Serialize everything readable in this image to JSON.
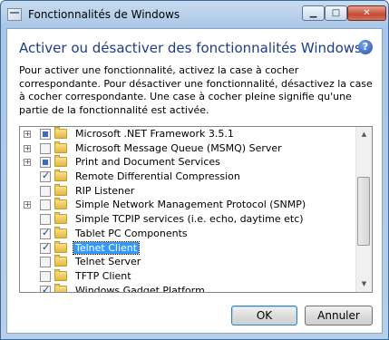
{
  "window": {
    "title": "Fonctionnalités de Windows",
    "icon": "windows-features-icon",
    "buttons": {
      "minimize": "▁",
      "maximize": "□",
      "close": "✕"
    }
  },
  "heading": "Activer ou désactiver des fonctionnalités Windows",
  "help_icon": "?",
  "description": "Pour activer une fonctionnalité, activez la case à cocher correspondante. Pour désactiver une fonctionnalité, désactivez la case à cocher correspondante. Une case à cocher pleine signifie qu'une partie de la fonctionnalité est activée.",
  "features": [
    {
      "label": "Microsoft .NET Framework 3.5.1",
      "expander": "+",
      "state": "partial"
    },
    {
      "label": "Microsoft Message Queue (MSMQ) Server",
      "expander": "+",
      "state": "unchecked"
    },
    {
      "label": "Print and Document Services",
      "expander": "+",
      "state": "partial"
    },
    {
      "label": "Remote Differential Compression",
      "expander": "",
      "state": "checked"
    },
    {
      "label": "RIP Listener",
      "expander": "",
      "state": "unchecked"
    },
    {
      "label": "Simple Network Management Protocol (SNMP)",
      "expander": "+",
      "state": "unchecked"
    },
    {
      "label": "Simple TCPIP services (i.e. echo, daytime etc)",
      "expander": "",
      "state": "unchecked"
    },
    {
      "label": "Tablet PC Components",
      "expander": "",
      "state": "checked"
    },
    {
      "label": "Telnet Client",
      "expander": "",
      "state": "checked",
      "selected": true
    },
    {
      "label": "Telnet Server",
      "expander": "",
      "state": "unchecked"
    },
    {
      "label": "TFTP Client",
      "expander": "",
      "state": "unchecked"
    },
    {
      "label": "Windows Gadget Platform",
      "expander": "",
      "state": "checked"
    }
  ],
  "scroll": {
    "up": "▲",
    "down": "▼"
  },
  "footer": {
    "ok_label": "OK",
    "cancel_label": "Annuler"
  }
}
